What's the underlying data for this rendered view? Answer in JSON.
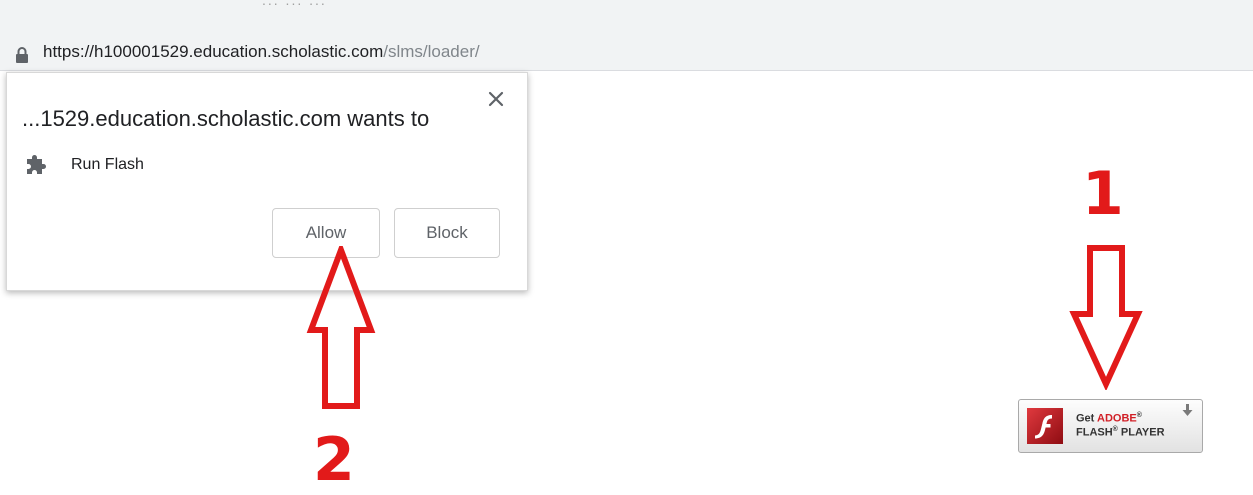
{
  "browser": {
    "top_strip_text": "... ... ...",
    "url": {
      "host": "https://h100001529.education.scholastic.com",
      "path": "/slms/loader/"
    }
  },
  "permission_popup": {
    "title": "...1529.education.scholastic.com wants to",
    "permission_label": "Run Flash",
    "allow_label": "Allow",
    "block_label": "Block"
  },
  "flash_badge": {
    "get_text": "Get ",
    "brand_text": "ADOBE",
    "reg_mark_1": "®",
    "product_text": "FLASH",
    "reg_mark_2": "®",
    "player_text": " PLAYER"
  },
  "annotations": {
    "step_1": "1",
    "step_2": "2",
    "color": "#e21a1a"
  },
  "icons": {
    "lock": "lock-icon",
    "close": "close-icon",
    "puzzle": "puzzle-icon",
    "flash_logo": "flash-logo-icon",
    "download": "download-icon"
  }
}
